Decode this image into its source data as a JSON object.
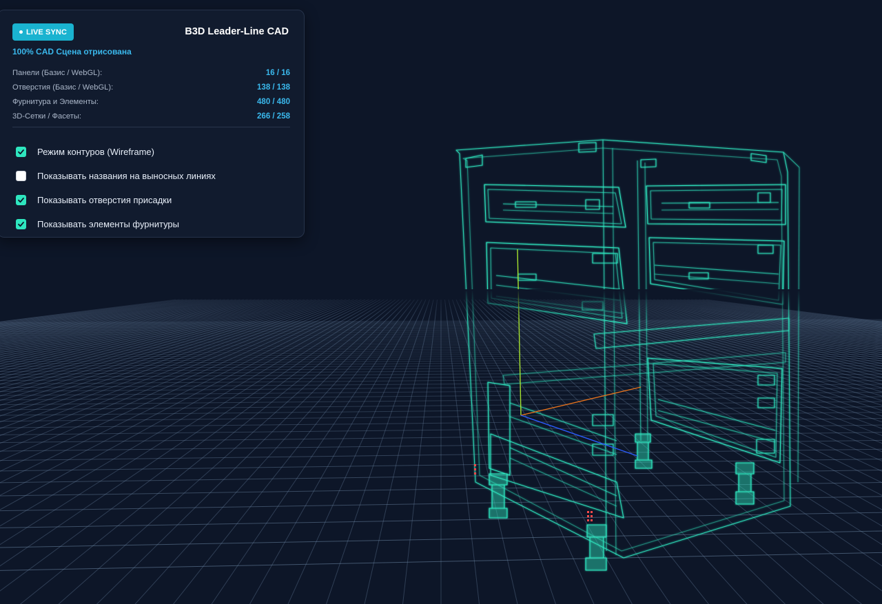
{
  "header": {
    "badge_label": "LIVE SYNC",
    "app_title": "B3D Leader-Line CAD",
    "status_text": "100% CAD Сцена отрисована"
  },
  "stats": [
    {
      "label": "Панели (Базис / WebGL):",
      "value": "16 / 16"
    },
    {
      "label": "Отверстия (Базис / WebGL):",
      "value": "138 / 138"
    },
    {
      "label": "Фурнитура и Элементы:",
      "value": "480 / 480"
    },
    {
      "label": "3D-Сетки / Фасеты:",
      "value": "266 / 258"
    }
  ],
  "options": [
    {
      "label": "Режим контуров (Wireframe)",
      "checked": true
    },
    {
      "label": "Показывать названия на выносных линиях",
      "checked": false
    },
    {
      "label": "Показывать отверстия присадки",
      "checked": true
    },
    {
      "label": "Показывать элементы фурнитуры",
      "checked": true
    }
  ],
  "colors": {
    "background": "#0d1628",
    "panel": "#111b2e",
    "accent_badge": "#1ab3d0",
    "accent_text": "#3ab8ec",
    "checkbox_on": "#2ee6bf",
    "wireframe": "#2ee6bf",
    "grid": "#6f8aa8",
    "axis_x": "#e8731c",
    "axis_y": "#a6e22e",
    "axis_z": "#2b5cff"
  }
}
